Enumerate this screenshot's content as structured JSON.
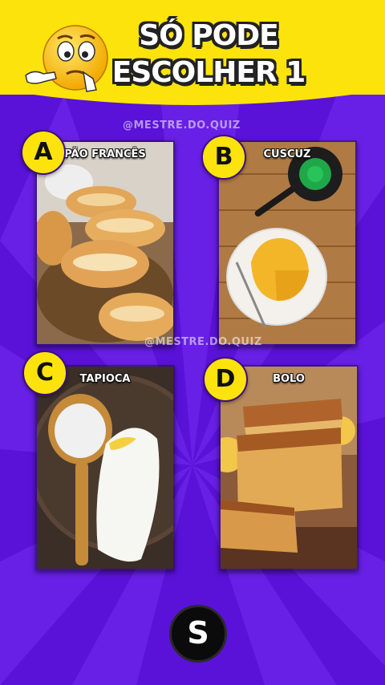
{
  "header": {
    "title_line1": "SÓ PODE",
    "title_line2": "ESCOLHER 1",
    "emoji_icon": "thinking-face-icon"
  },
  "watermarks": {
    "top": "@MESTRE.DO.QUIZ",
    "middle": "@MESTRE.DO.QUIZ"
  },
  "options": [
    {
      "letter": "A",
      "label": "PÃO FRANCÊS",
      "image": "bread-rolls-image"
    },
    {
      "letter": "B",
      "label": "CUSCUZ",
      "image": "couscous-image"
    },
    {
      "letter": "C",
      "label": "TAPIOCA",
      "image": "tapioca-image"
    },
    {
      "letter": "D",
      "label": "BOLO",
      "image": "cake-image"
    }
  ],
  "footer": {
    "logo_text": "S"
  },
  "colors": {
    "background": "#5a12d8",
    "header": "#fde30c",
    "badge": "#fde30c"
  }
}
